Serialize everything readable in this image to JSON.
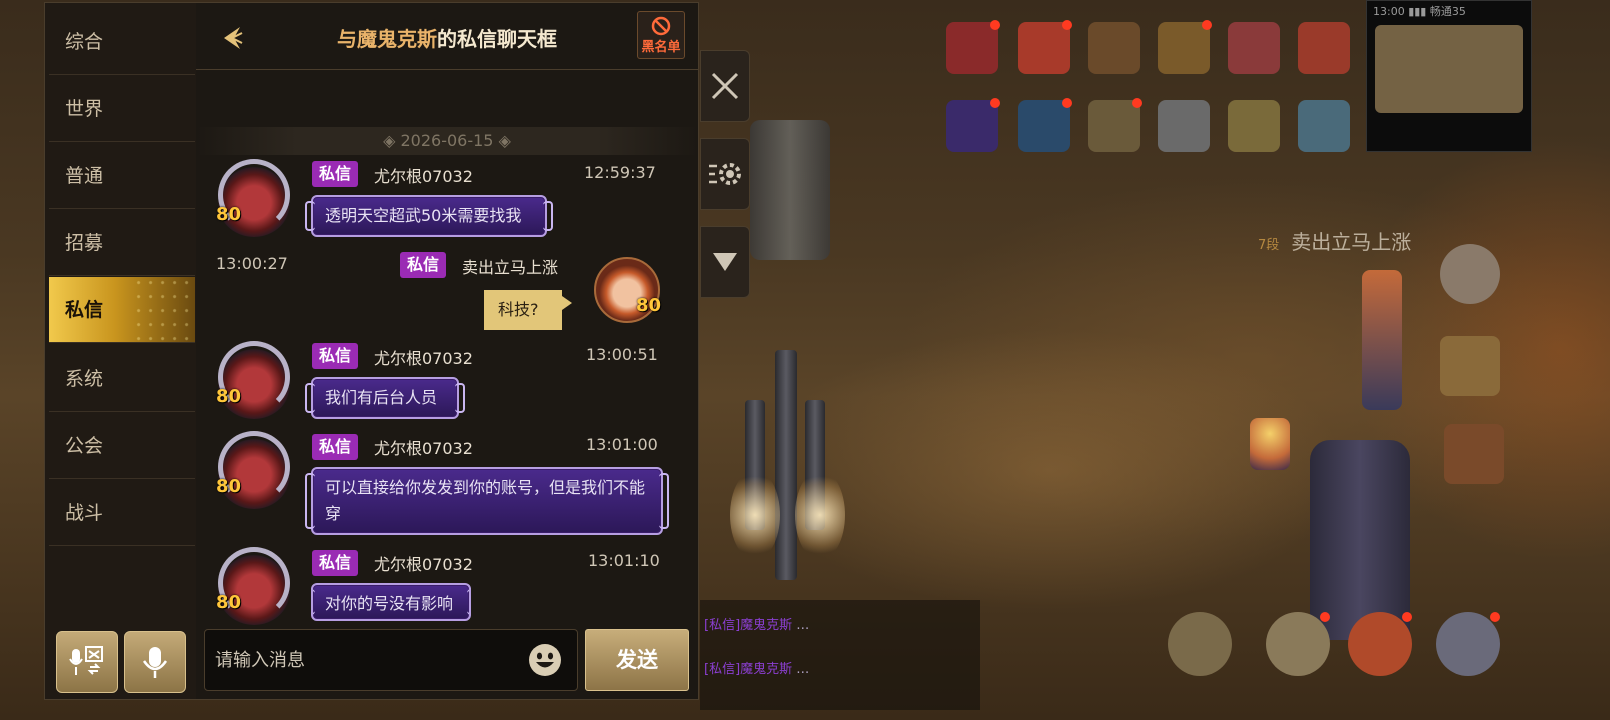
{
  "sidebar": {
    "items": [
      {
        "label": "综合",
        "active": false
      },
      {
        "label": "世界",
        "active": false
      },
      {
        "label": "普通",
        "active": false
      },
      {
        "label": "招募",
        "active": false
      },
      {
        "label": "私信",
        "active": true
      },
      {
        "label": "系统",
        "active": false
      },
      {
        "label": "公会",
        "active": false
      },
      {
        "label": "战斗",
        "active": false
      }
    ],
    "translate_icon": "speech-translate-icon",
    "voice_icon": "microphone-icon"
  },
  "chat": {
    "title_name": "与魔鬼克斯",
    "title_suffix": "的私信聊天框",
    "blacklist_label": "黑名单",
    "date_divider": "◈ 2026-06-15 ◈",
    "messages": [
      {
        "from": "other",
        "tag": "私信",
        "sender": "尤尔根07032",
        "time": "12:59:37",
        "level": "80",
        "text": "透明天空超武50米需要找我"
      },
      {
        "from": "me",
        "tag": "私信",
        "sender": "卖出立马上涨",
        "time": "13:00:27",
        "level": "80",
        "text": "科技?"
      },
      {
        "from": "other",
        "tag": "私信",
        "sender": "尤尔根07032",
        "time": "13:00:51",
        "level": "80",
        "text": "我们有后台人员"
      },
      {
        "from": "other",
        "tag": "私信",
        "sender": "尤尔根07032",
        "time": "13:01:00",
        "level": "80",
        "text": "可以直接给你发发到你的账号，但是我们不能穿"
      },
      {
        "from": "other",
        "tag": "私信",
        "sender": "尤尔根07032",
        "time": "13:01:10",
        "level": "80",
        "text": "对你的号没有影响"
      }
    ],
    "input_placeholder": "请输入消息",
    "send_label": "发送"
  },
  "hud": {
    "floating_prefix": "7段",
    "floating_text": "卖出立马上涨",
    "statusbar": "13:00  ▮▮▮ 畅通35"
  },
  "colors": {
    "accent_gold": "#e2c679",
    "private_tag": "#9a2bb4",
    "bubble_purple": "#3a2070",
    "level_yellow": "#ffc63a",
    "title_name": "#e9b36a"
  }
}
